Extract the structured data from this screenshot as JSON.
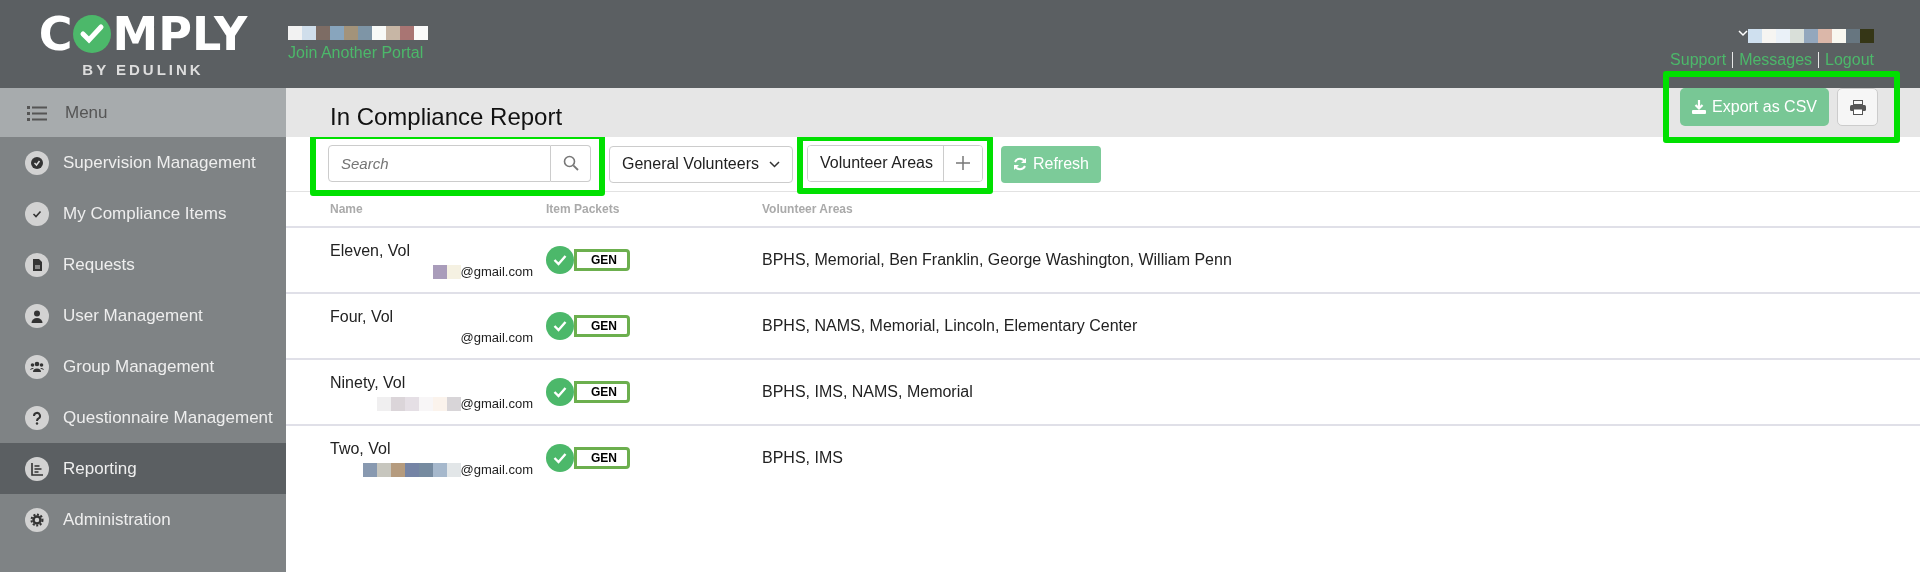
{
  "logo": {
    "left": "C",
    "right": "MPLY",
    "tagline": "BY EDULINK"
  },
  "header": {
    "portal_link": "Join Another Portal",
    "links": [
      "Support",
      "Messages",
      "Logout"
    ]
  },
  "sidebar": {
    "menu_label": "Menu",
    "items": [
      {
        "label": "Supervision Management",
        "selected": false
      },
      {
        "label": "My Compliance Items",
        "selected": false
      },
      {
        "label": "Requests",
        "selected": false
      },
      {
        "label": "User Management",
        "selected": false
      },
      {
        "label": "Group Management",
        "selected": false
      },
      {
        "label": "Questionnaire Management",
        "selected": false
      },
      {
        "label": "Reporting",
        "selected": true
      },
      {
        "label": "Administration",
        "selected": false
      }
    ]
  },
  "page": {
    "title": "In Compliance Report",
    "export_button": "Export as CSV"
  },
  "toolbar": {
    "search_placeholder": "Search",
    "group_dropdown": "General Volunteers",
    "areas_filter": "Volunteer Areas",
    "refresh_button": "Refresh"
  },
  "table": {
    "columns": [
      "Name",
      "Item Packets",
      "Volunteer Areas"
    ],
    "rows": [
      {
        "name": "Eleven, Vol",
        "email": "@gmail.com",
        "packet": "GEN",
        "packet_complete": true,
        "areas": "BPHS, Memorial, Ben Franklin, George Washington, William Penn"
      },
      {
        "name": "Four, Vol",
        "email": "@gmail.com",
        "packet": "GEN",
        "packet_complete": true,
        "areas": "BPHS, NAMS, Memorial, Lincoln, Elementary Center"
      },
      {
        "name": "Ninety, Vol",
        "email": "@gmail.com",
        "packet": "GEN",
        "packet_complete": true,
        "areas": "BPHS, IMS, NAMS, Memorial"
      },
      {
        "name": "Two, Vol",
        "email": "@gmail.com",
        "packet": "GEN",
        "packet_complete": true,
        "areas": "BPHS, IMS"
      }
    ]
  }
}
